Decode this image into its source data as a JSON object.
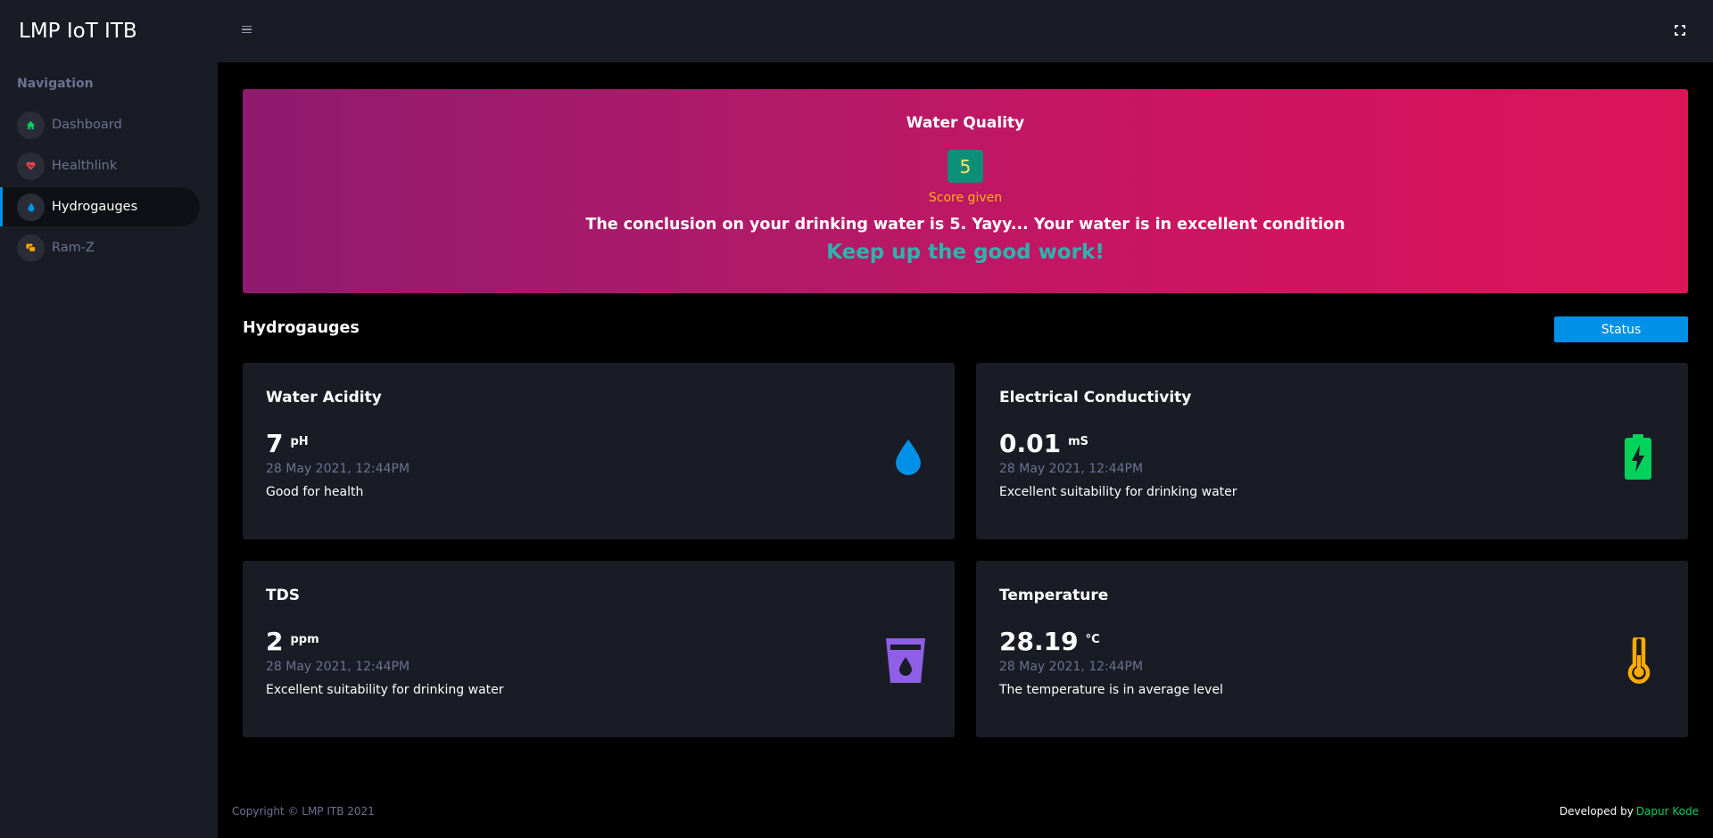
{
  "app": {
    "brand": "LMP IoT ITB"
  },
  "sidebar": {
    "heading": "Navigation",
    "items": [
      {
        "label": "Dashboard",
        "icon": "home-icon",
        "color": "#00d25b"
      },
      {
        "label": "Healthlink",
        "icon": "heart-icon",
        "color": "#fc424a"
      },
      {
        "label": "Hydrogauges",
        "icon": "water-drop-icon",
        "color": "#0090e7",
        "active": true
      },
      {
        "label": "Ram-Z",
        "icon": "chat-icon",
        "color": "#ffab00"
      }
    ]
  },
  "banner": {
    "title": "Water Quality",
    "score": "5",
    "score_label": "Score given",
    "conclusion": "The conclusion on your drinking water is 5. Yayy... Your water is in excellent condition",
    "cheer": "Keep up the good work!"
  },
  "section": {
    "title": "Hydrogauges",
    "status_button": "Status"
  },
  "cards": [
    {
      "title": "Water Acidity",
      "value": "7",
      "unit": "pH",
      "date": "28 May 2021, 12:44PM",
      "desc": "Good for health",
      "icon": "water-drop-icon",
      "color": "#0090e7"
    },
    {
      "title": "Electrical Conductivity",
      "value": "0.01",
      "unit": "mS",
      "date": "28 May 2021, 12:44PM",
      "desc": "Excellent suitability for drinking water",
      "icon": "battery-charging-icon",
      "color": "#00d25b"
    },
    {
      "title": "TDS",
      "value": "2",
      "unit": "ppm",
      "date": "28 May 2021, 12:44PM",
      "desc": "Excellent suitability for drinking water",
      "icon": "cup-water-icon",
      "color": "#8f5fe8"
    },
    {
      "title": "Temperature",
      "value": "28.19",
      "unit": "°C",
      "date": "28 May 2021, 12:44PM",
      "desc": "The temperature is in average level",
      "icon": "thermometer-icon",
      "color": "#ffab00"
    }
  ],
  "footer": {
    "copyright": "Copyright © LMP ITB 2021",
    "developed_by": "Developed by",
    "developer": "Dapur Kode"
  }
}
